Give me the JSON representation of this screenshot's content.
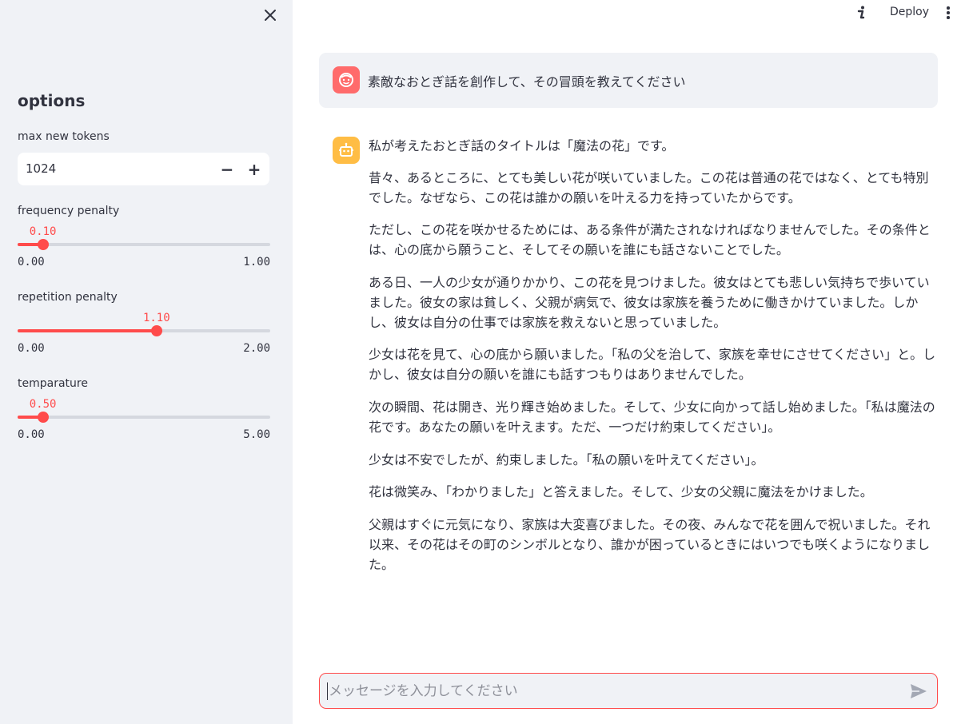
{
  "sidebar": {
    "title": "options",
    "max_new_tokens": {
      "label": "max new tokens",
      "value": "1024",
      "minus": "−",
      "plus": "+"
    },
    "sliders": [
      {
        "label": "frequency penalty",
        "current": "0.10",
        "min": "0.00",
        "max": "1.00",
        "fraction": 0.1
      },
      {
        "label": "repetition penalty",
        "current": "1.10",
        "min": "0.00",
        "max": "2.00",
        "fraction": 0.55
      },
      {
        "label": "temparature",
        "current": "0.50",
        "min": "0.00",
        "max": "5.00",
        "fraction": 0.1
      }
    ]
  },
  "topbar": {
    "deploy_label": "Deploy"
  },
  "chat": {
    "user_message": "素敵なおとぎ話を創作して、その冒頭を教えてください",
    "bot_paragraphs": [
      "私が考えたおとぎ話のタイトルは「魔法の花」です。",
      "昔々、あるところに、とても美しい花が咲いていました。この花は普通の花ではなく、とても特別でした。なぜなら、この花は誰かの願いを叶える力を持っていたからです。",
      "ただし、この花を咲かせるためには、ある条件が満たされなければなりませんでした。その条件とは、心の底から願うこと、そしてその願いを誰にも話さないことでした。",
      "ある日、一人の少女が通りかかり、この花を見つけました。彼女はとても悲しい気持ちで歩いていました。彼女の家は貧しく、父親が病気で、彼女は家族を養うために働きかけていました。しかし、彼女は自分の仕事では家族を救えないと思っていました。",
      "少女は花を見て、心の底から願いました。「私の父を治して、家族を幸せにさせてください」と。しかし、彼女は自分の願いを誰にも話すつもりはありませんでした。",
      "次の瞬間、花は開き、光り輝き始めました。そして、少女に向かって話し始めました。「私は魔法の花です。あなたの願いを叶えます。ただ、一つだけ約束してください」。",
      "少女は不安でしたが、約束しました。「私の願いを叶えてください」。",
      "花は微笑み、「わかりました」と答えました。そして、少女の父親に魔法をかけました。",
      "父親はすぐに元気になり、家族は大変喜びました。その夜、みんなで花を囲んで祝いました。それ以来、その花はその町のシンボルとなり、誰かが困っているときにはいつでも咲くようになりました。"
    ],
    "input_placeholder": "メッセージを入力してください"
  },
  "icons": {
    "close": "close-icon",
    "info": "info-icon",
    "more": "kebab-menu-icon",
    "user_avatar": "user-face-icon",
    "bot_avatar": "robot-icon",
    "send": "send-icon"
  },
  "colors": {
    "accent": "#ff4b4b",
    "sidebar_bg": "#f0f2f6",
    "user_avatar_bg": "#ff6b6b",
    "bot_avatar_bg": "#ffbd45",
    "text": "#31333f"
  }
}
